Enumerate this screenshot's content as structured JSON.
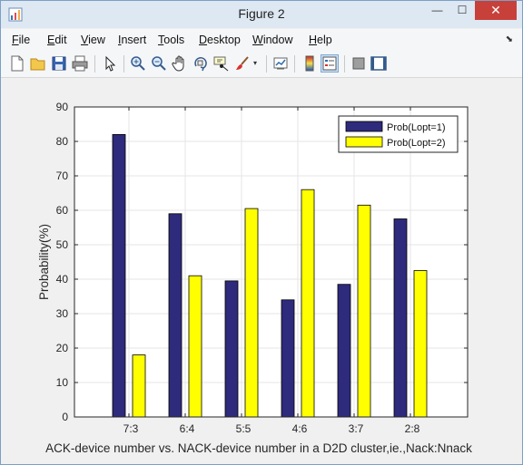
{
  "window": {
    "title": "Figure 2",
    "close_glyph": "✕",
    "min_glyph": "—",
    "max_glyph": "☐"
  },
  "menu": [
    {
      "label": "File",
      "key": "F"
    },
    {
      "label": "Edit",
      "key": "E"
    },
    {
      "label": "View",
      "key": "V"
    },
    {
      "label": "Insert",
      "key": "I"
    },
    {
      "label": "Tools",
      "key": "T"
    },
    {
      "label": "Desktop",
      "key": "D"
    },
    {
      "label": "Window",
      "key": "W"
    },
    {
      "label": "Help",
      "key": "H"
    }
  ],
  "toolbar": {
    "icons": [
      "new-figure-icon",
      "open-file-icon",
      "save-icon",
      "print-icon",
      "pointer-icon",
      "zoom-in-icon",
      "zoom-out-icon",
      "pan-hand-icon",
      "rotate-3d-icon",
      "data-cursor-icon",
      "brush-icon",
      "brush-dropdown-icon",
      "link-plot-icon",
      "colorbar-icon",
      "legend-icon",
      "hide-plot-tools-icon",
      "show-plot-tools-icon"
    ]
  },
  "chart_data": {
    "type": "bar",
    "categories": [
      "7:3",
      "6:4",
      "5:5",
      "4:6",
      "3:7",
      "2:8"
    ],
    "series": [
      {
        "name": "Prob(Lopt=1)",
        "color": "#2e2a7c",
        "values": [
          82,
          59,
          39.5,
          34,
          38.5,
          57.5
        ]
      },
      {
        "name": "Prob(Lopt=2)",
        "color": "#ffff00",
        "values": [
          18,
          41,
          60.5,
          66,
          61.5,
          42.5
        ]
      }
    ],
    "xlabel": "ACK-device number vs. NACK-device number in a D2D cluster,ie.,Nack:Nnack",
    "ylabel": "Probability(%)",
    "ylim": [
      0,
      90
    ],
    "yticks": [
      0,
      10,
      20,
      30,
      40,
      50,
      60,
      70,
      80,
      90
    ],
    "grid": true,
    "legend_position": "top-right"
  }
}
